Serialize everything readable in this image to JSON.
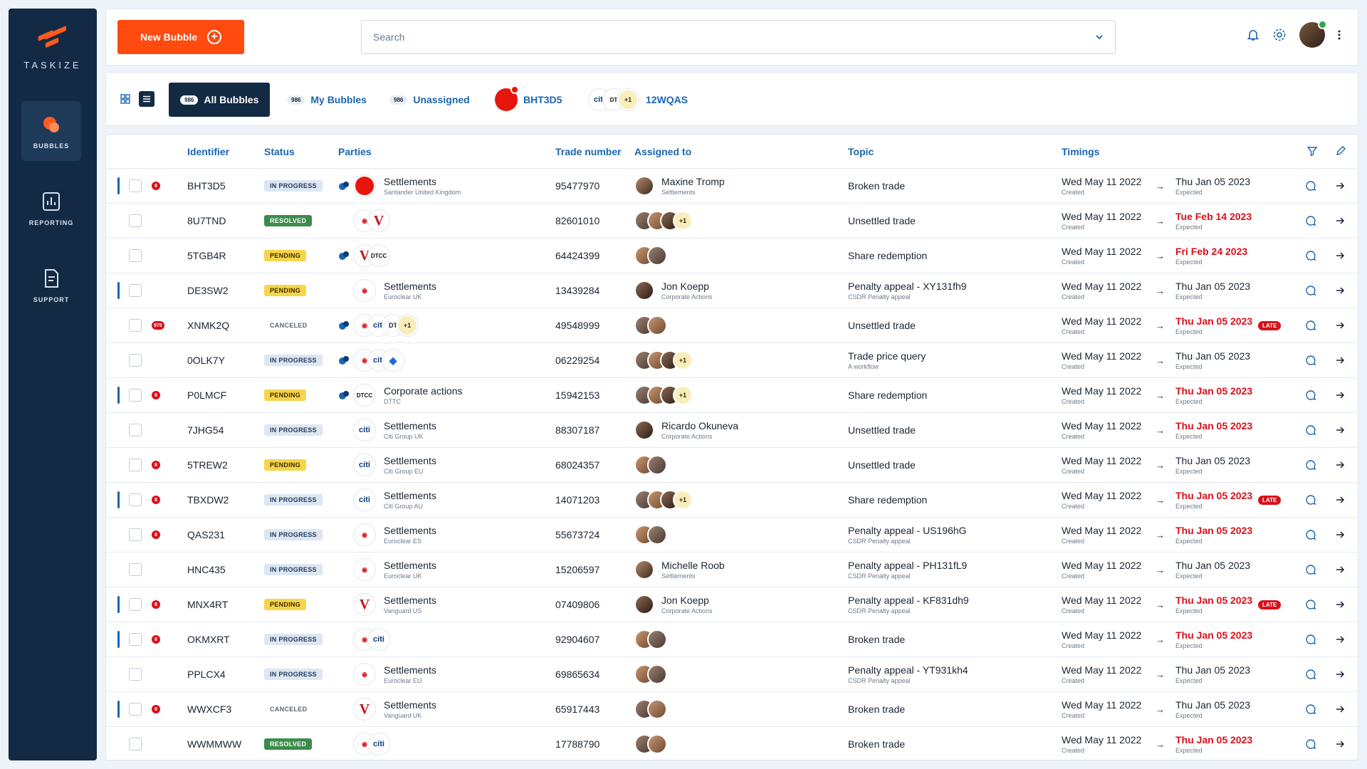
{
  "brand": {
    "name": "TASKIZE",
    "color": "#ff5a1f"
  },
  "sidebar": {
    "items": [
      {
        "label": "BUBBLES",
        "icon": "bubbles-icon",
        "active": true
      },
      {
        "label": "REPORTING",
        "icon": "reporting-icon",
        "active": false
      },
      {
        "label": "SUPPORT",
        "icon": "support-icon",
        "active": false
      }
    ]
  },
  "header": {
    "new_bubble_label": "New Bubble",
    "search_placeholder": "Search"
  },
  "tabs": [
    {
      "label": "All Bubbles",
      "count": "986",
      "active": true
    },
    {
      "label": "My Bubbles",
      "count": "986"
    },
    {
      "label": "Unassigned",
      "count": "986"
    },
    {
      "label": "BHT3D5"
    },
    {
      "label": "12WQAS",
      "more": "+1"
    }
  ],
  "columns": [
    "Identifier",
    "Status",
    "Parties",
    "Trade number",
    "Assigned to",
    "Topic",
    "Timings"
  ],
  "rows": [
    {
      "id": "BHT3D5",
      "status": "IN PROGRESS",
      "party": "Settlements",
      "party_sub": "Santander United Kingdom",
      "trade": "95477970",
      "assignee": "Maxine Tromp",
      "assignee_sub": "Settlements",
      "topic": "Broken trade",
      "topic_sub": "",
      "created": "Wed May 11 2022",
      "created_label": "Created",
      "expected": "Thu Jan 05 2023",
      "expected_label": "Expected",
      "unread": "8"
    },
    {
      "id": "8U7TND",
      "status": "RESOLVED",
      "party": "",
      "party_sub": "",
      "trade": "82601010",
      "assignee": "",
      "assignee_sub": "",
      "assignee_more": "+1",
      "topic": "Unsettled trade",
      "topic_sub": "",
      "created": "Wed May 11 2022",
      "created_label": "Created",
      "expected": "Tue Feb 14 2023",
      "expected_label": "Expected"
    },
    {
      "id": "5TGB4R",
      "status": "PENDING",
      "party": "",
      "party_sub": "",
      "trade": "64424399",
      "assignee": "",
      "assignee_sub": "",
      "topic": "Share redemption",
      "topic_sub": "",
      "created": "Wed May 11 2022",
      "created_label": "Created",
      "expected": "Fri Feb 24 2023",
      "expected_label": "Expected"
    },
    {
      "id": "DE3SW2",
      "status": "PENDING",
      "party": "Settlements",
      "party_sub": "Euroclear UK",
      "trade": "13439284",
      "assignee": "Jon Koepp",
      "assignee_sub": "Corporate Actions",
      "topic": "Penalty appeal - XY131fh9",
      "topic_sub": "CSDR Penalty appeal",
      "created": "Wed May 11 2022",
      "created_label": "Created",
      "expected": "Thu Jan 05 2023",
      "expected_label": "Expected"
    },
    {
      "id": "XNMK2Q",
      "status": "CANCELED",
      "party": "",
      "party_sub": "",
      "party_more": "+1",
      "trade": "49548999",
      "assignee": "",
      "assignee_sub": "",
      "topic": "Unsettled trade",
      "topic_sub": "",
      "created": "Wed May 11 2022",
      "created_label": "Created",
      "expected": "Thu Jan 05 2023",
      "expected_label": "Expected",
      "late": "LATE",
      "unread": "975"
    },
    {
      "id": "0OLK7Y",
      "status": "IN PROGRESS",
      "party": "",
      "party_sub": "",
      "trade": "06229254",
      "assignee": "",
      "assignee_sub": "",
      "assignee_more": "+1",
      "topic": "Trade price query",
      "topic_sub": "A workflow",
      "created": "Wed May 11 2022",
      "created_label": "Created",
      "expected": "Thu Jan 05 2023",
      "expected_label": "Expected"
    },
    {
      "id": "P0LMCF",
      "status": "PENDING",
      "party": "Corporate actions",
      "party_sub": "DTTC",
      "trade": "15942153",
      "assignee": "",
      "assignee_sub": "",
      "assignee_more": "+1",
      "topic": "Share redemption",
      "topic_sub": "",
      "created": "Wed May 11 2022",
      "created_label": "Created",
      "expected": "Thu Jan 05 2023",
      "expected_label": "Expected",
      "unread": "8"
    },
    {
      "id": "7JHG54",
      "status": "IN PROGRESS",
      "party": "Settlements",
      "party_sub": "Citi Group UK",
      "trade": "88307187",
      "assignee": "Ricardo Okuneva",
      "assignee_sub": "Corporate Actions",
      "topic": "Unsettled trade",
      "topic_sub": "",
      "created": "Wed May 11 2022",
      "created_label": "Created",
      "expected": "Thu Jan 05 2023",
      "expected_label": "Expected"
    },
    {
      "id": "5TREW2",
      "status": "PENDING",
      "party": "Settlements",
      "party_sub": "Citi Group EU",
      "trade": "68024357",
      "assignee": "",
      "assignee_sub": "",
      "topic": "Unsettled trade",
      "topic_sub": "",
      "created": "Wed May 11 2022",
      "created_label": "Created",
      "expected": "Thu Jan 05 2023",
      "expected_label": "Expected",
      "unread": "8"
    },
    {
      "id": "TBXDW2",
      "status": "IN PROGRESS",
      "party": "Settlements",
      "party_sub": "Citi Group AU",
      "trade": "14071203",
      "assignee": "",
      "assignee_sub": "",
      "assignee_more": "+1",
      "topic": "Share redemption",
      "topic_sub": "",
      "created": "Wed May 11 2022",
      "created_label": "Created",
      "expected": "Thu Jan 05 2023",
      "expected_label": "Expected",
      "late": "LATE",
      "unread": "8"
    },
    {
      "id": "QAS231",
      "status": "IN PROGRESS",
      "party": "Settlements",
      "party_sub": "Euroclear ES",
      "trade": "55673724",
      "assignee": "",
      "assignee_sub": "",
      "topic": "Penalty appeal - US196hG",
      "topic_sub": "CSDR Penalty appeal",
      "created": "Wed May 11 2022",
      "created_label": "Created",
      "expected": "Thu Jan 05 2023",
      "expected_label": "Expected",
      "unread": "8"
    },
    {
      "id": "HNC435",
      "status": "IN PROGRESS",
      "party": "Settlements",
      "party_sub": "Euroclear UK",
      "trade": "15206597",
      "assignee": "Michelle Roob",
      "assignee_sub": "Settlements",
      "topic": "Penalty appeal - PH131fL9",
      "topic_sub": "CSDR Penalty appeal",
      "created": "Wed May 11 2022",
      "created_label": "Created",
      "expected": "Thu Jan 05 2023",
      "expected_label": "Expected"
    },
    {
      "id": "MNX4RT",
      "status": "PENDING",
      "party": "Settlements",
      "party_sub": "Vanguard US",
      "trade": "07409806",
      "assignee": "Jon Koepp",
      "assignee_sub": "Corporate Actions",
      "topic": "Penalty appeal - KF831dh9",
      "topic_sub": "CSDR Penalty appeal",
      "created": "Wed May 11 2022",
      "created_label": "Created",
      "expected": "Thu Jan 05 2023",
      "expected_label": "Expected",
      "late": "LATE",
      "unread": "8"
    },
    {
      "id": "OKMXRT",
      "status": "IN PROGRESS",
      "party": "",
      "party_sub": "",
      "trade": "92904607",
      "assignee": "",
      "assignee_sub": "",
      "topic": "Broken trade",
      "topic_sub": "",
      "created": "Wed May 11 2022",
      "created_label": "Created",
      "expected": "Thu Jan 05 2023",
      "expected_label": "Expected",
      "unread": "8"
    },
    {
      "id": "PPLCX4",
      "status": "IN PROGRESS",
      "party": "Settlements",
      "party_sub": "Euroclear EU",
      "trade": "69865634",
      "assignee": "",
      "assignee_sub": "",
      "topic": "Penalty appeal - YT931kh4",
      "topic_sub": "CSDR Penalty appeal",
      "created": "Wed May 11 2022",
      "created_label": "Created",
      "expected": "Thu Jan 05 2023",
      "expected_label": "Expected"
    },
    {
      "id": "WWXCF3",
      "status": "CANCELED",
      "party": "Settlements",
      "party_sub": "Vanguard UK",
      "trade": "65917443",
      "assignee": "",
      "assignee_sub": "",
      "topic": "Broken trade",
      "topic_sub": "",
      "created": "Wed May 11 2022",
      "created_label": "Created",
      "expected": "Thu Jan 05 2023",
      "expected_label": "Expected",
      "unread": "8"
    },
    {
      "id": "WWMMWW",
      "status": "RESOLVED",
      "party": "",
      "party_sub": "",
      "trade": "17788790",
      "assignee": "",
      "assignee_sub": "",
      "topic": "Broken trade",
      "topic_sub": "",
      "created": "Wed May 11 2022",
      "created_label": "Created",
      "expected": "Thu Jan 05 2023",
      "expected_label": "Expected"
    }
  ],
  "logos": {
    "citi": "citi",
    "dtcc": "DTCC",
    "dt": "DT",
    "vanguard": "V"
  },
  "colors": {
    "accent": "#ff4a10",
    "navy": "#132a44",
    "link": "#1a66b0",
    "late": "#d8101a"
  }
}
